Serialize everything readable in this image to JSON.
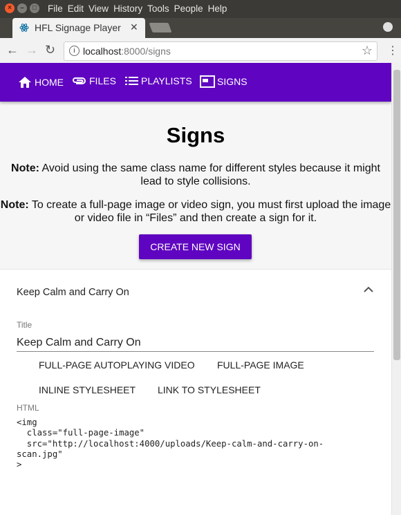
{
  "window": {
    "menu": [
      "File",
      "Edit",
      "View",
      "History",
      "Tools",
      "People",
      "Help"
    ]
  },
  "tab": {
    "title": "HFL Signage Player"
  },
  "url": {
    "host": "localhost",
    "path": ":8000/signs"
  },
  "nav": {
    "home": "HOME",
    "files": "FILES",
    "playlists": "PLAYLISTS",
    "signs": "SIGNS"
  },
  "page": {
    "heading": "Signs",
    "note_label": "Note:",
    "note1": "Avoid using the same class name for different styles because it might lead to style collisions.",
    "note2": "To create a full-page image or video sign, you must first upload the image or video file in “Files” and then create a sign for it.",
    "create_button": "CREATE NEW SIGN"
  },
  "sign": {
    "panel_title": "Keep Calm and Carry On",
    "title_label": "Title",
    "title_value": "Keep Calm and Carry On",
    "buttons": [
      "FULL-PAGE AUTOPLAYING VIDEO",
      "FULL-PAGE IMAGE",
      "INLINE STYLESHEET",
      "LINK TO STYLESHEET"
    ],
    "html_label": "HTML",
    "html_code": "<img\n  class=\"full-page-image\"\n  src=\"http://localhost:4000/uploads/Keep-calm-and-carry-on-\nscan.jpg\"\n>"
  },
  "colors": {
    "primary": "#5f04c0"
  }
}
